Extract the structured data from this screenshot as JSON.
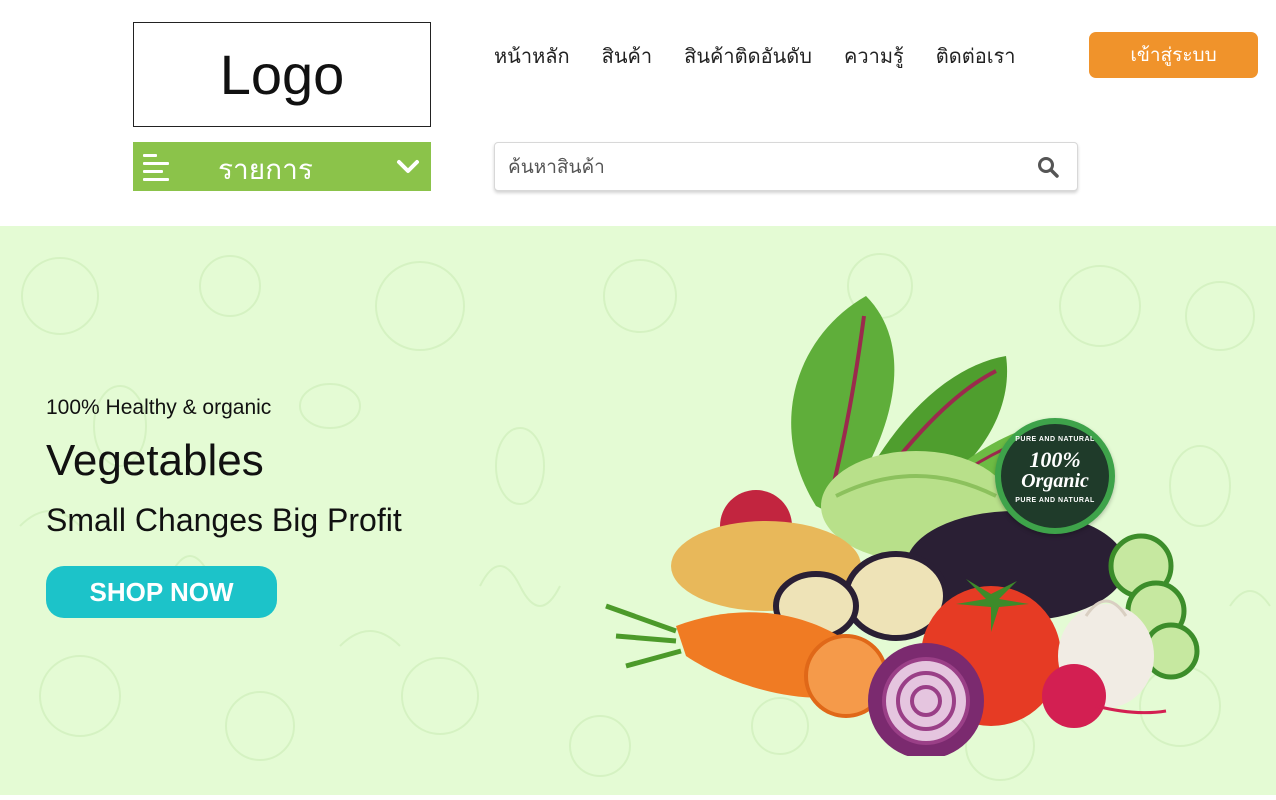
{
  "header": {
    "logo_text": "Logo",
    "nav": [
      "หน้าหลัก",
      "สินค้า",
      "สินค้าติดอันดับ",
      "ความรู้",
      "ติดต่อเรา"
    ],
    "login_label": "เข้าสู่ระบบ"
  },
  "category_menu": {
    "label": "รายการ",
    "icon": "hamburger-icon",
    "toggle_icon": "chevron-down-icon"
  },
  "search": {
    "placeholder": "ค้นหาสินค้า",
    "value": "",
    "icon": "search-icon"
  },
  "hero": {
    "eyebrow": "100% Healthy & organic",
    "headline": "Vegetables",
    "tagline": "Small Changes Big Profit",
    "cta_label": "SHOP NOW",
    "badge_top": "PURE AND NATURAL",
    "badge_main_1": "100%",
    "badge_main_2": "Organic",
    "badge_bottom": "PURE AND NATURAL"
  },
  "colors": {
    "accent_orange": "#f0932b",
    "menu_green": "#8bc34a",
    "hero_bg": "#e4fbd4",
    "cta_teal": "#1cc3c9"
  }
}
